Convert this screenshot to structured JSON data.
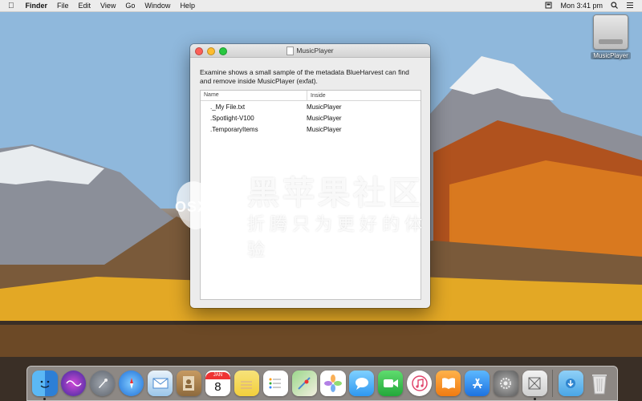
{
  "menubar": {
    "apple_icon": "apple-icon",
    "app_name": "Finder",
    "menus": [
      "File",
      "Edit",
      "View",
      "Go",
      "Window",
      "Help"
    ],
    "clock": "Mon 3:41 pm"
  },
  "desktop": {
    "drive_label": "MusicPlayer"
  },
  "window": {
    "title": "MusicPlayer",
    "description": "Examine shows a small sample of the metadata BlueHarvest can find and remove inside MusicPlayer (exfat).",
    "columns": [
      "Name",
      "Inside"
    ],
    "rows": [
      {
        "name": "._My File.txt",
        "inside": "MusicPlayer"
      },
      {
        "name": ".Spotlight-V100",
        "inside": "MusicPlayer"
      },
      {
        "name": ".TemporaryItems",
        "inside": "MusicPlayer"
      }
    ]
  },
  "watermark": {
    "site": "OSX.CX",
    "title": "黑苹果社区",
    "slogan": "折腾只为更好的体验"
  },
  "dock": {
    "apps": [
      {
        "name": "finder-icon",
        "color": "#3aa0f0"
      },
      {
        "name": "siri-icon",
        "color": "#6a3fd0"
      },
      {
        "name": "launchpad-icon",
        "color": "#8a8f99"
      },
      {
        "name": "safari-icon",
        "color": "#2f8ee8"
      },
      {
        "name": "mail-icon",
        "color": "#4aa3e8"
      },
      {
        "name": "contacts-icon",
        "color": "#b08a55"
      },
      {
        "name": "calendar-icon",
        "color": "#ffffff"
      },
      {
        "name": "notes-icon",
        "color": "#f5d25a"
      },
      {
        "name": "reminders-icon",
        "color": "#ffffff"
      },
      {
        "name": "maps-icon",
        "color": "#6cc46a"
      },
      {
        "name": "photos-icon",
        "color": "#ffffff"
      },
      {
        "name": "messages-icon",
        "color": "#4fb6f5"
      },
      {
        "name": "facetime-icon",
        "color": "#2fbf4a"
      },
      {
        "name": "itunes-icon",
        "color": "#f0f0f0"
      },
      {
        "name": "ibooks-icon",
        "color": "#f28a1c"
      },
      {
        "name": "app-store-icon",
        "color": "#2c8ef0"
      },
      {
        "name": "system-preferences-icon",
        "color": "#7d7d7d"
      },
      {
        "name": "blueharvest-icon",
        "color": "#d9d9d9"
      },
      {
        "name": "downloads-folder-icon",
        "color": "#58b6ee"
      },
      {
        "name": "trash-icon",
        "color": "#e3e3e3"
      }
    ],
    "calendar_day": "8",
    "calendar_month": "JAN"
  }
}
